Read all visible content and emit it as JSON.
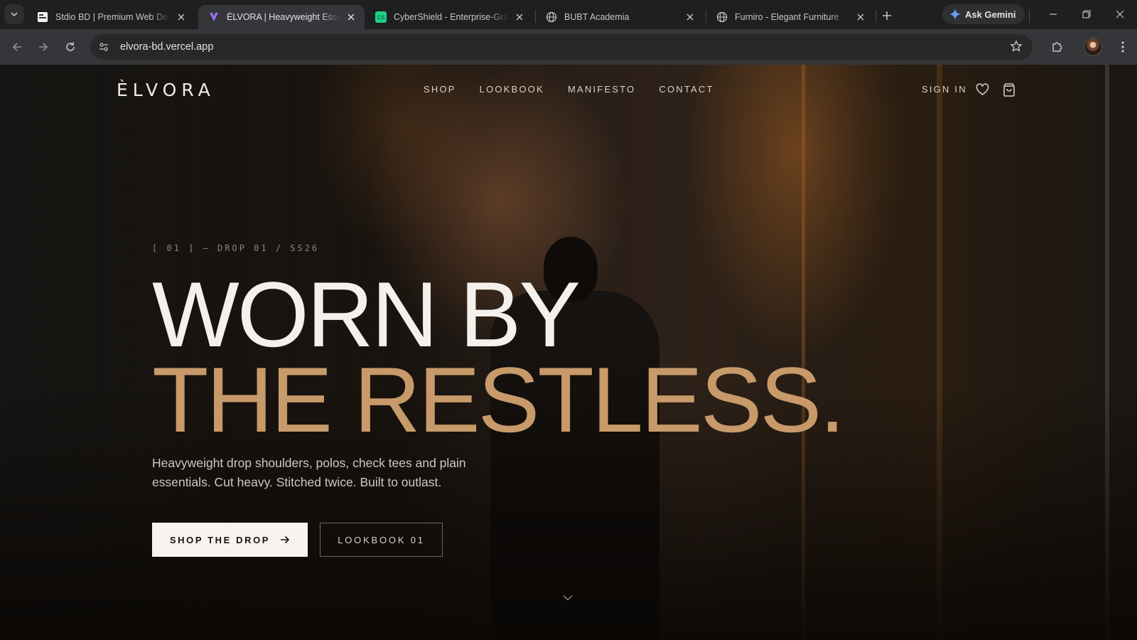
{
  "browser": {
    "tabs": [
      {
        "title": "Stdio BD | Premium Web Desi",
        "favicon": "stdio-favicon",
        "active": false
      },
      {
        "title": "ÈLVORA | Heavyweight Essent",
        "favicon": "elvora-favicon",
        "active": true
      },
      {
        "title": "CyberShield - Enterprise-Grad",
        "favicon": "cybershield-favicon",
        "active": false
      },
      {
        "title": "BUBT Academia",
        "favicon": "globe-icon",
        "active": false
      },
      {
        "title": "Furniro - Elegant Furniture",
        "favicon": "globe-icon",
        "active": false
      }
    ],
    "gemini_label": "Ask Gemini",
    "url": "elvora-bd.vercel.app"
  },
  "site": {
    "logo": "ÈLVORA",
    "nav": [
      "SHOP",
      "LOOKBOOK",
      "MANIFESTO",
      "CONTACT"
    ],
    "sign_in": "SIGN IN"
  },
  "hero": {
    "eyebrow": "[ 01 ] — DROP 01 / SS26",
    "headline_line1": "WORN BY",
    "headline_line2": "THE RESTLESS.",
    "lead": "Heavyweight drop shoulders, polos, check tees and plain essentials. Cut heavy. Stitched twice. Built to outlast.",
    "primary_cta": "SHOP THE DROP",
    "secondary_cta": "LOOKBOOK 01"
  },
  "colors": {
    "accent": "#c89a6a",
    "headline": "#f4f1ec",
    "chrome_bg": "#1f1f1f",
    "toolbar_bg": "#35363a"
  }
}
